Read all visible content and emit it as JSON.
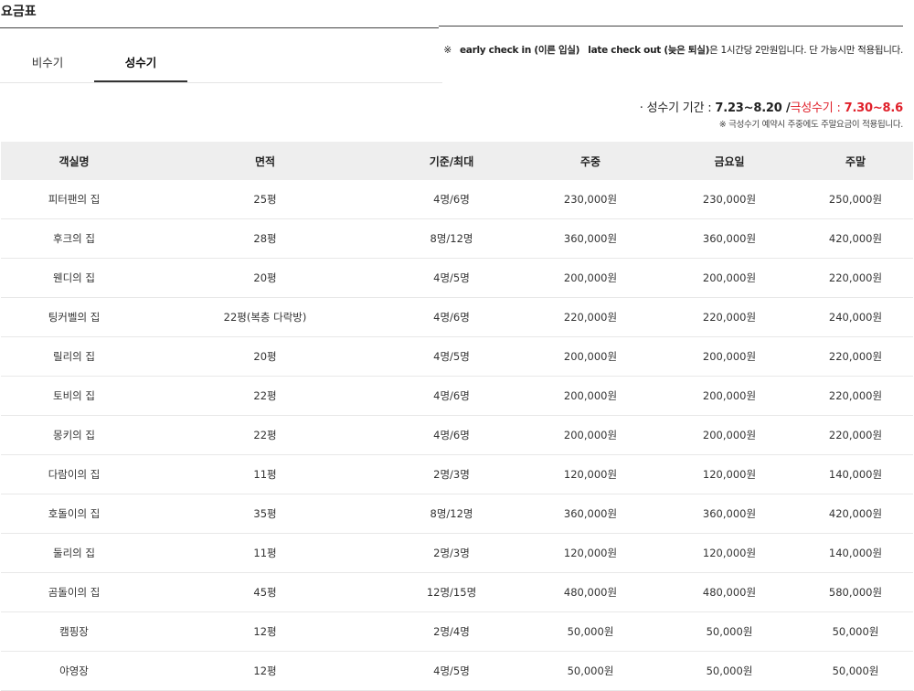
{
  "page": {
    "title": "요금표",
    "notice": {
      "prefix": "※",
      "early": "early check in (이른 입실)",
      "late": "late check out (늦은 퇴실)",
      "rest": "은 1시간당 2만원입니다. 단 가능시만 적용됩니다."
    }
  },
  "tabs": [
    {
      "label": "비수기",
      "active": false
    },
    {
      "label": "성수기",
      "active": true
    }
  ],
  "season": {
    "bullet": "·",
    "peak_label": "성수기 기간 : ",
    "peak_range": "7.23~8.20",
    "separator": " /",
    "super_label": "극성수기 : ",
    "super_range": "7.30~8.6",
    "note": "※ 극성수기 예약시 주중에도 주말요금이 적용됩니다."
  },
  "colors": {
    "friday": "#3a6fc4",
    "weekend": "#e0202a",
    "header_bg": "#eeeeee"
  },
  "table": {
    "headers": {
      "name": "객실명",
      "area": "면적",
      "capacity": "기준/최대",
      "weekday": "주중",
      "friday": "금요일",
      "weekend": "주말"
    },
    "rows": [
      {
        "name": "피터팬의 집",
        "area": "25평",
        "capacity": "4명/6명",
        "weekday": "230,000원",
        "friday": "230,000원",
        "weekend": "250,000원"
      },
      {
        "name": "후크의 집",
        "area": "28평",
        "capacity": "8명/12명",
        "weekday": "360,000원",
        "friday": "360,000원",
        "weekend": "420,000원"
      },
      {
        "name": "웬디의 집",
        "area": "20평",
        "capacity": "4명/5명",
        "weekday": "200,000원",
        "friday": "200,000원",
        "weekend": "220,000원"
      },
      {
        "name": "팅커벨의 집",
        "area": "22평(복층 다락방)",
        "capacity": "4명/6명",
        "weekday": "220,000원",
        "friday": "220,000원",
        "weekend": "240,000원"
      },
      {
        "name": "릴리의 집",
        "area": "20평",
        "capacity": "4명/5명",
        "weekday": "200,000원",
        "friday": "200,000원",
        "weekend": "220,000원"
      },
      {
        "name": "토비의 집",
        "area": "22평",
        "capacity": "4명/6명",
        "weekday": "200,000원",
        "friday": "200,000원",
        "weekend": "220,000원"
      },
      {
        "name": "몽키의 집",
        "area": "22평",
        "capacity": "4명/6명",
        "weekday": "200,000원",
        "friday": "200,000원",
        "weekend": "220,000원"
      },
      {
        "name": "다람이의 집",
        "area": "11평",
        "capacity": "2명/3명",
        "weekday": "120,000원",
        "friday": "120,000원",
        "weekend": "140,000원"
      },
      {
        "name": "호돌이의 집",
        "area": "35평",
        "capacity": "8명/12명",
        "weekday": "360,000원",
        "friday": "360,000원",
        "weekend": "420,000원"
      },
      {
        "name": "둘리의 집",
        "area": "11평",
        "capacity": "2명/3명",
        "weekday": "120,000원",
        "friday": "120,000원",
        "weekend": "140,000원"
      },
      {
        "name": "곰돌이의 집",
        "area": "45평",
        "capacity": "12명/15명",
        "weekday": "480,000원",
        "friday": "480,000원",
        "weekend": "580,000원"
      },
      {
        "name": "캠핑장",
        "area": "12평",
        "capacity": "2명/4명",
        "weekday": "50,000원",
        "friday": "50,000원",
        "weekend": "50,000원"
      },
      {
        "name": "야영장",
        "area": "12평",
        "capacity": "4명/5명",
        "weekday": "50,000원",
        "friday": "50,000원",
        "weekend": "50,000원"
      }
    ]
  }
}
